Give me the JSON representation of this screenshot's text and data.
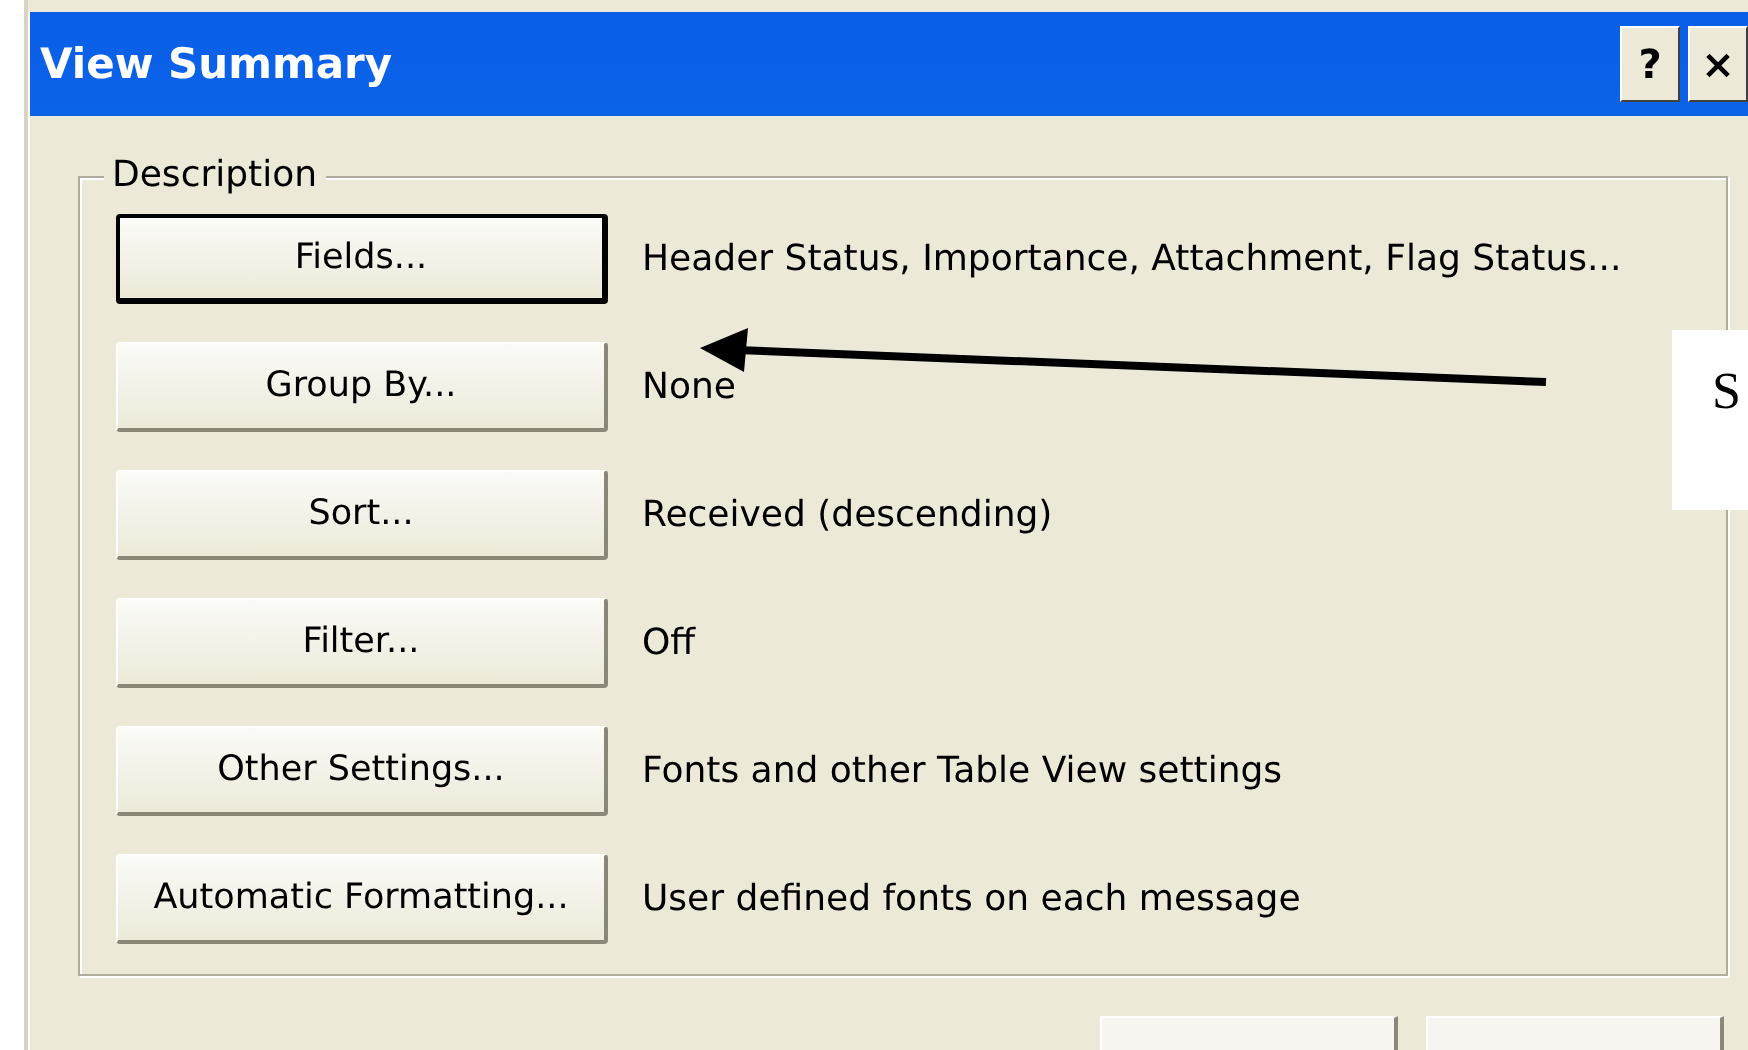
{
  "window": {
    "title": "View Summary",
    "help_button": "?",
    "close_button": "×"
  },
  "group": {
    "title": "Description"
  },
  "rows": [
    {
      "button": "Fields...",
      "default": true,
      "value": "Header Status, Importance, Attachment, Flag Status..."
    },
    {
      "button": "Group By...",
      "default": false,
      "value": "None"
    },
    {
      "button": "Sort...",
      "default": false,
      "value": "Received (descending)"
    },
    {
      "button": "Filter...",
      "default": false,
      "value": "Off"
    },
    {
      "button": "Other Settings...",
      "default": false,
      "value": "Fonts and other Table View settings"
    },
    {
      "button": "Automatic Formatting...",
      "default": false,
      "value": "User defined fonts on each message"
    }
  ],
  "callout": {
    "text": "S"
  }
}
